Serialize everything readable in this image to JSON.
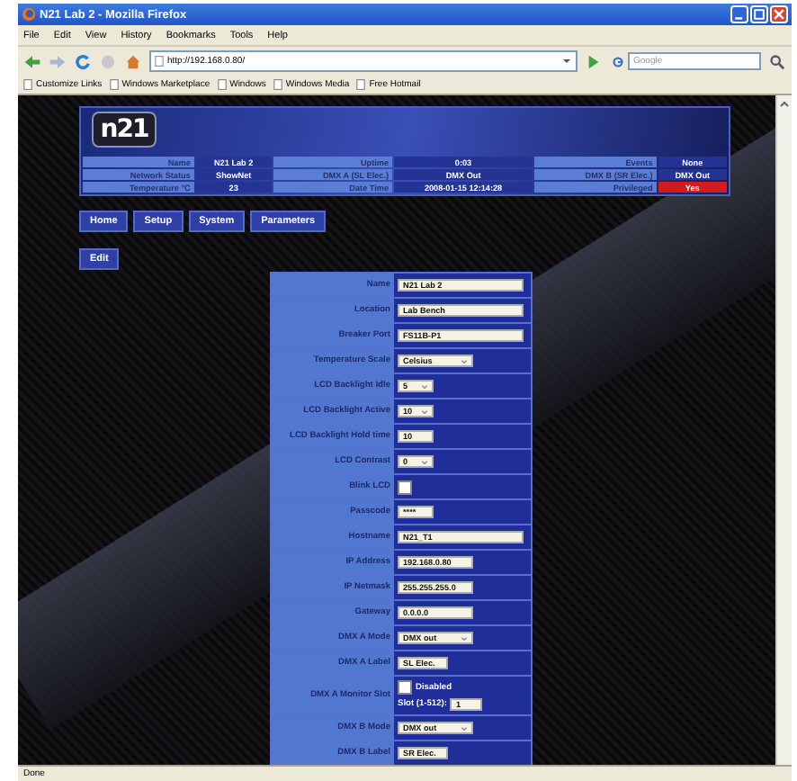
{
  "window": {
    "title": "N21 Lab 2 - Mozilla Firefox"
  },
  "menu": [
    "File",
    "Edit",
    "View",
    "History",
    "Bookmarks",
    "Tools",
    "Help"
  ],
  "address": "http://192.168.0.80/",
  "search": {
    "placeholder": "Google"
  },
  "bookmarks": [
    "Customize Links",
    "Windows Marketplace",
    "Windows",
    "Windows Media",
    "Free Hotmail"
  ],
  "header": {
    "logo": "n21",
    "info": [
      [
        {
          "label": "Name",
          "value": "N21 Lab 2",
          "alert": false
        },
        {
          "label": "Uptime",
          "value": "0:03",
          "alert": false
        },
        {
          "label": "Events",
          "value": "None",
          "alert": false
        }
      ],
      [
        {
          "label": "Network Status",
          "value": "ShowNet",
          "alert": false
        },
        {
          "label": "DMX A (SL Elec.)",
          "value": "DMX Out",
          "alert": false
        },
        {
          "label": "DMX B (SR Elec.)",
          "value": "DMX Out",
          "alert": false
        }
      ],
      [
        {
          "label": "Temperature °C",
          "value": "23",
          "alert": false
        },
        {
          "label": "Date Time",
          "value": "2008-01-15 12:14:28",
          "alert": false
        },
        {
          "label": "Privileged",
          "value": "Yes",
          "alert": true
        }
      ]
    ]
  },
  "nav": [
    "Home",
    "Setup",
    "System",
    "Parameters"
  ],
  "edit_button": "Edit",
  "form": [
    {
      "label": "Name",
      "kind": "text",
      "value": "N21 Lab 2"
    },
    {
      "label": "Location",
      "kind": "text",
      "value": "Lab Bench"
    },
    {
      "label": "Breaker Port",
      "kind": "text",
      "value": "FS11B-P1"
    },
    {
      "label": "Temperature Scale",
      "kind": "select",
      "value": "Celsius"
    },
    {
      "label": "LCD Backlight Idle",
      "kind": "select",
      "value": "5"
    },
    {
      "label": "LCD Backlight Active",
      "kind": "select",
      "value": "10"
    },
    {
      "label": "LCD Backlight Hold time",
      "kind": "text",
      "value": "10"
    },
    {
      "label": "LCD Contrast",
      "kind": "select",
      "value": "0"
    },
    {
      "label": "Blink LCD",
      "kind": "checkbox",
      "checked": false
    },
    {
      "label": "Passcode",
      "kind": "text",
      "value": "****"
    },
    {
      "label": "Hostname",
      "kind": "text",
      "value": "N21_T1"
    },
    {
      "label": "IP Address",
      "kind": "text",
      "value": "192.168.0.80"
    },
    {
      "label": "IP Netmask",
      "kind": "text",
      "value": "255.255.255.0"
    },
    {
      "label": "Gateway",
      "kind": "text",
      "value": "0.0.0.0"
    },
    {
      "label": "DMX A Mode",
      "kind": "select",
      "value": "DMX out"
    },
    {
      "label": "DMX A Label",
      "kind": "text",
      "value": "SL Elec."
    },
    {
      "label": "DMX A Monitor Slot",
      "kind": "monitor",
      "checked": false,
      "check_label": "Disabled",
      "slot_label": "Slot (1-512):",
      "value": "1"
    },
    {
      "label": "DMX B Mode",
      "kind": "select",
      "value": "DMX out"
    },
    {
      "label": "DMX B Label",
      "kind": "text",
      "value": "SR Elec."
    }
  ],
  "status_bar": "Done"
}
